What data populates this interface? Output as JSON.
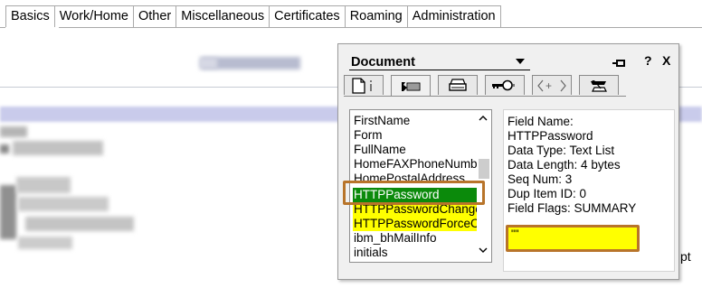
{
  "tabs": [
    "Basics",
    "Work/Home",
    "Other",
    "Miscellaneous",
    "Certificates",
    "Roaming",
    "Administration"
  ],
  "background": {
    "trailing_text": "pt"
  },
  "panel": {
    "title": "Document",
    "help_label": "?",
    "close_label": "X",
    "icon_tabs": [
      "document-info-icon",
      "field-list-icon",
      "print-icon",
      "key-icon",
      "html-tags-icon",
      "design-icon"
    ],
    "fields": [
      "FirstName",
      "Form",
      "FullName",
      "HomeFAXPhoneNumb",
      "HomePostalAddress",
      "HTTPPassword",
      "HTTPPasswordChangeDate",
      "HTTPPasswordForceChange",
      "ibm_bhMailInfo",
      "initials"
    ],
    "selected_field": "HTTPPassword",
    "field_info": {
      "field_name_label": "Field Name:",
      "field_name": "HTTPPassword",
      "data_type": "Data Type: Text List",
      "data_length": "Data Length: 4 bytes",
      "seq_num": "Seq Num: 3",
      "dup_item_id": "Dup Item ID: 0",
      "field_flags": "Field Flags: SUMMARY",
      "value": "\"\""
    }
  },
  "colors": {
    "selected": "#0b8a0b",
    "highlight": "#ffff00",
    "annotation": "#b8742a"
  }
}
